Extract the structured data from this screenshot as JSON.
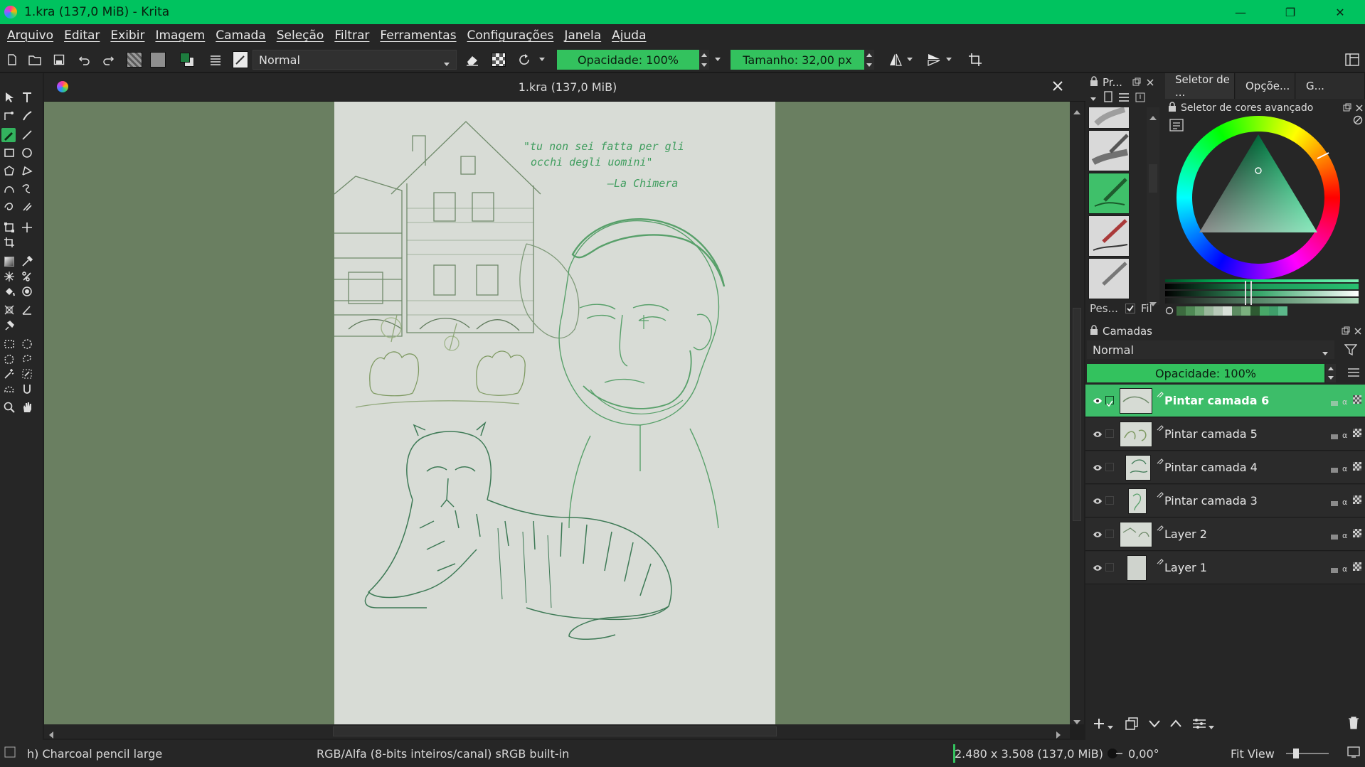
{
  "window": {
    "title": "1.kra (137,0 MiB)  - Krita",
    "minimize": "—",
    "restore": "❐",
    "close": "✕"
  },
  "menu": [
    "Arquivo",
    "Editar",
    "Exibir",
    "Imagem",
    "Camada",
    "Seleção",
    "Filtrar",
    "Ferramentas",
    "Configurações",
    "Janela",
    "Ajuda"
  ],
  "toolbar": {
    "blend_mode": "Normal",
    "opacity": "Opacidade: 100%",
    "size": "Tamanho: 32,00 px"
  },
  "document": {
    "tab_title": "1.kra (137,0 MiB)",
    "artwork": {
      "quote": "\"tu non sei fatta per gli occhi degli uomini\"",
      "quote_line1": "\"tu non sei fatta per gli",
      "quote_line2": "occhi degli uomini\"",
      "attribution": "—La Chimera"
    }
  },
  "presets_dock": {
    "title": "Pr...",
    "footer_search": "Pes...",
    "footer_filter": "Fil"
  },
  "color_dock": {
    "tabs": [
      "Seletor de ...",
      "Opçõe...",
      "G..."
    ],
    "title": "Seletor de cores avançado",
    "history_colors": [
      "#3c6b3f",
      "#4f8a55",
      "#6fa574",
      "#9ab89c",
      "#b8c9b9",
      "#d8e0d8",
      "#5d8c62",
      "#7bb07e",
      "#2e5a32",
      "#48a868",
      "#3f9e6a",
      "#5cb88a"
    ]
  },
  "layers_dock": {
    "title": "Camadas",
    "blend_mode": "Normal",
    "opacity": "Opacidade:  100%",
    "layers": [
      {
        "name": "Pintar camada 6",
        "active": true
      },
      {
        "name": "Pintar camada 5",
        "active": false
      },
      {
        "name": "Pintar camada 4",
        "active": false
      },
      {
        "name": "Pintar camada 3",
        "active": false
      },
      {
        "name": "Layer 2",
        "active": false
      },
      {
        "name": "Layer 1",
        "active": false
      }
    ]
  },
  "status": {
    "brush": "h) Charcoal pencil large",
    "color_space": "RGB/Alfa (8-bits inteiros/canal)  sRGB built-in",
    "dimensions": "2.480 x 3.508 (137,0 MiB)",
    "rotation": "0,00°",
    "zoom": "Fit View"
  }
}
